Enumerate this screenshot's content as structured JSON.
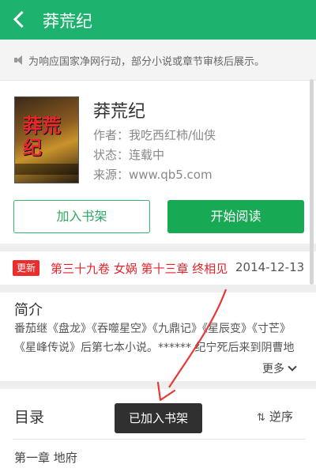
{
  "header": {
    "title": "莽荒纪"
  },
  "notice": {
    "text": "为响应国家净网行动，部分小说或章节审核后展示。"
  },
  "book": {
    "name": "莽荒纪",
    "author": "作者：我吃西红柿/仙侠",
    "status": "状态：连载中",
    "source": "来源：www.qb5.com",
    "cover_text": "莽荒纪"
  },
  "actions": {
    "add_label": "加入书架",
    "read_label": "开始阅读"
  },
  "update": {
    "tag": "更新",
    "chapter": "第三十九卷 女娲 第十三章 终相见",
    "date": "2014-12-13"
  },
  "intro": {
    "heading": "简介",
    "text": "番茄继《盘龙》《吞噬星空》《九鼎记》《星辰变》《寸芒》《星峰传说》后第七本小说。****** 纪宁死后来到阴曹地",
    "more_label": "更多"
  },
  "toc": {
    "heading": "目录",
    "sort_label": "逆序",
    "first_chapter": "第一章 地府"
  },
  "toast": {
    "text": "已加入书架"
  },
  "colors": {
    "primary": "#1db36f",
    "read_button": "#18a954",
    "update_red": "#e3242b",
    "annotation": "#e53935"
  }
}
